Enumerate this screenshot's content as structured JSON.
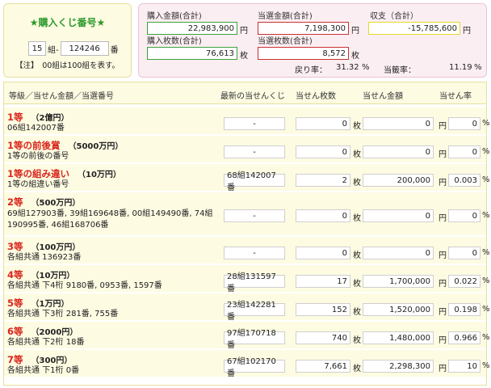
{
  "purchase": {
    "title": "★購入くじ番号★",
    "set": "15",
    "set_suffix": "組-",
    "number": "124246",
    "number_suffix": "番",
    "note": "【注】　00組は100組を表す。"
  },
  "summary": {
    "purchase_amount_label": "購入金額(合計)",
    "purchase_amount": "22,983,900",
    "yen": "円",
    "win_amount_label": "当選金額(合計)",
    "win_amount": "7,198,300",
    "balance_label": "収支（合計）",
    "balance": "-15,785,600",
    "purchase_count_label": "購入枚数(合計)",
    "purchase_count": "76,613",
    "mai": "枚",
    "win_count_label": "当選枚数(合計)",
    "win_count": "8,572",
    "return_rate_label": "戻り率：",
    "return_rate": "31.32",
    "win_rate_label": "当籤率：",
    "win_rate": "11.19",
    "percent": "%"
  },
  "table": {
    "headers": {
      "prize": "等級／当せん金額／当選番号",
      "latest": "最新の当せんくじ",
      "count": "当せん枚数",
      "amount": "当せん金額",
      "rate": "当せん率"
    },
    "unit_mai": "枚",
    "unit_yen": "円",
    "unit_pct": "%",
    "rows": [
      {
        "name": "1等",
        "amount": "（2億円）",
        "numbers": "06組142007番",
        "latest": "-",
        "count": "0",
        "win": "0",
        "rate": "0"
      },
      {
        "name": "1等の前後賞",
        "amount": "（5000万円）",
        "numbers": "1等の前後の番号",
        "latest": "-",
        "count": "0",
        "win": "0",
        "rate": "0"
      },
      {
        "name": "1等の組み違い",
        "amount": "（10万円）",
        "numbers": "1等の組違い番号",
        "latest": "68組142007番",
        "count": "2",
        "win": "200,000",
        "rate": "0.003"
      },
      {
        "name": "2等",
        "amount": "（500万円）",
        "numbers": "69組127903番, 39組169648番, 00組149490番, 74組190995番, 46組168706番",
        "latest": "-",
        "count": "0",
        "win": "0",
        "rate": "0"
      },
      {
        "name": "3等",
        "amount": "（100万円）",
        "numbers": "各組共通 136923番",
        "latest": "-",
        "count": "0",
        "win": "0",
        "rate": "0"
      },
      {
        "name": "4等",
        "amount": "（10万円）",
        "numbers": "各組共通 下4桁 9180番, 0953番, 1597番",
        "latest": "28組131597番",
        "count": "17",
        "win": "1,700,000",
        "rate": "0.022"
      },
      {
        "name": "5等",
        "amount": "（1万円）",
        "numbers": "各組共通 下3桁 281番, 755番",
        "latest": "23組142281番",
        "count": "152",
        "win": "1,520,000",
        "rate": "0.198"
      },
      {
        "name": "6等",
        "amount": "（2000円）",
        "numbers": "各組共通 下2桁 18番",
        "latest": "97組170718番",
        "count": "740",
        "win": "1,480,000",
        "rate": "0.966"
      },
      {
        "name": "7等",
        "amount": "（300円）",
        "numbers": "各組共通 下1桁 0番",
        "latest": "67組102170番",
        "count": "7,661",
        "win": "2,298,300",
        "rate": "10"
      }
    ]
  }
}
